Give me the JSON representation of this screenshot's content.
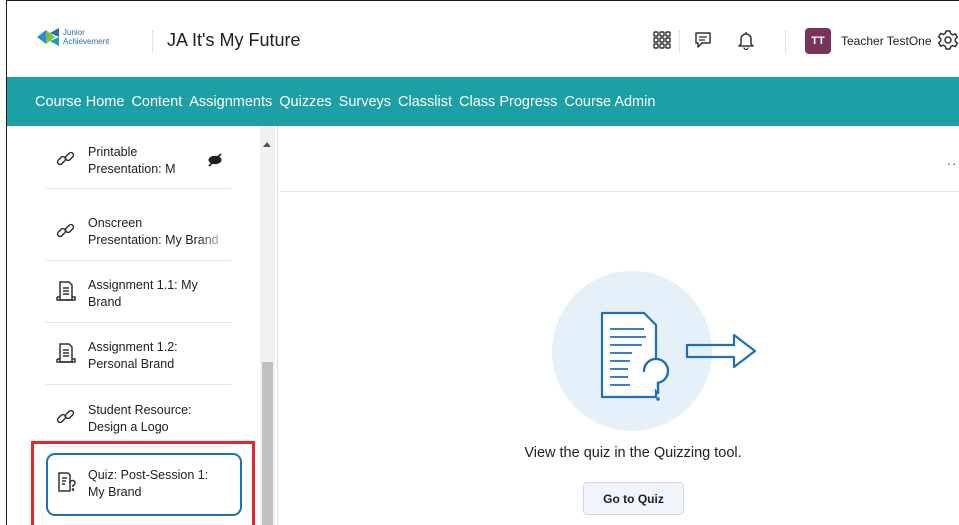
{
  "header": {
    "logo_line1": "Junior",
    "logo_line2": "Achievement",
    "course_title": "JA It's My Future",
    "avatar_initials": "TT",
    "user_name": "Teacher TestOne"
  },
  "nav": {
    "items": [
      "Course Home",
      "Content",
      "Assignments",
      "Quizzes",
      "Surveys",
      "Classlist",
      "Class Progress",
      "Course Admin"
    ]
  },
  "sidebar": {
    "items": [
      {
        "line1": "Printable",
        "line2": "Presentation: M",
        "icon": "link-icon",
        "extra": "hidden-eye-icon"
      },
      {
        "line1": "Onscreen",
        "line2": "Presentation: My Brand",
        "icon": "link-icon"
      },
      {
        "line1": "Assignment 1.1: My",
        "line2": "Brand",
        "icon": "assignment-icon"
      },
      {
        "line1": "Assignment 1.2:",
        "line2": "Personal Brand",
        "icon": "assignment-icon"
      },
      {
        "line1": "Student Resource:",
        "line2": "Design a Logo",
        "icon": "link-icon"
      },
      {
        "line1": "Quiz: Post-Session 1:",
        "line2": "My Brand",
        "icon": "quiz-icon",
        "selected": true
      }
    ]
  },
  "main": {
    "message": "View the quiz in the Quizzing tool.",
    "button_label": "Go to Quiz",
    "more_label": ".."
  },
  "colors": {
    "nav_bg": "#1d9fa6",
    "avatar_bg": "#78335a",
    "highlight_red": "#e8242b",
    "selected_blue": "#1f6fb8"
  }
}
